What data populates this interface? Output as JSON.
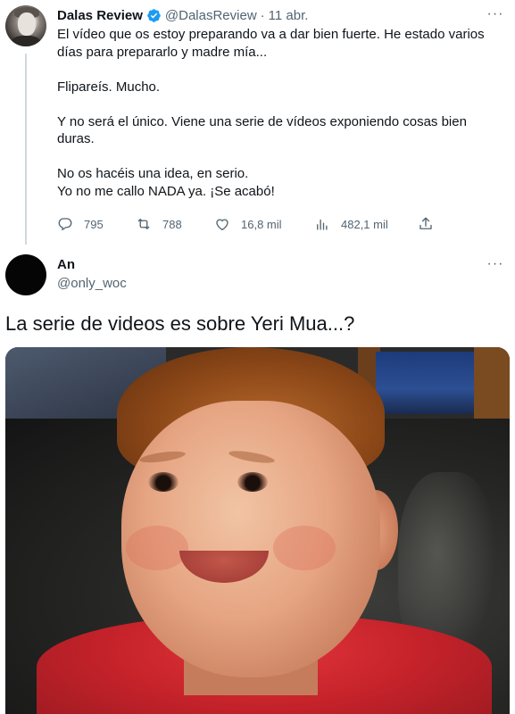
{
  "tweet1": {
    "author_name": "Dalas Review",
    "author_handle": "@DalasReview",
    "separator": "·",
    "date": "11 abr.",
    "more_label": "···",
    "paragraphs": [
      "El vídeo que os estoy preparando va a dar bien fuerte. He estado varios días para prepararlo y madre mía...",
      "Flipareís. Mucho.",
      "Y no será el único. Viene una serie de vídeos exponiendo cosas bien duras.",
      "No os hacéis una idea, en serio.",
      "Yo no me callo NADA ya. ¡Se acabó!"
    ],
    "stats": {
      "replies": "795",
      "retweets": "788",
      "likes": "16,8 mil",
      "views": "482,1 mil"
    },
    "icons": [
      "verified-badge-icon",
      "reply-icon",
      "retweet-icon",
      "like-icon",
      "views-icon",
      "share-icon"
    ],
    "accent_color": "#1d9bf0"
  },
  "tweet2": {
    "author_name": "An",
    "author_handle": "@only_woc",
    "more_label": "···",
    "text": "La serie de videos es sobre Yeri Mua...?"
  }
}
